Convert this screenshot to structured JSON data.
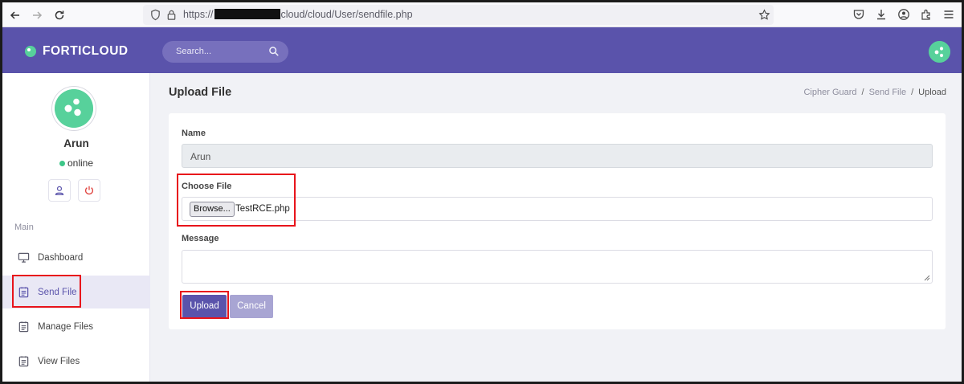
{
  "browser": {
    "url_prefix": "https://",
    "url_suffix": "cloud/cloud/User/sendfile.php"
  },
  "header": {
    "brand": "FORTICLOUD",
    "search_placeholder": "Search..."
  },
  "sidebar": {
    "user_name": "Arun",
    "status": "online",
    "section_label": "Main",
    "items": [
      {
        "label": "Dashboard",
        "icon": "monitor-icon",
        "active": false
      },
      {
        "label": "Send File",
        "icon": "clipboard-icon",
        "active": true
      },
      {
        "label": "Manage Files",
        "icon": "clipboard-icon",
        "active": false
      },
      {
        "label": "View Files",
        "icon": "clipboard-icon",
        "active": false
      }
    ]
  },
  "main": {
    "title": "Upload File",
    "breadcrumb": [
      "Cipher Guard",
      "Send File",
      "Upload"
    ],
    "form": {
      "name_label": "Name",
      "name_value": "Arun",
      "file_label": "Choose File",
      "browse_label": "Browse...",
      "file_name": "TestRCE.php",
      "message_label": "Message",
      "message_value": "",
      "upload_label": "Upload",
      "cancel_label": "Cancel"
    }
  },
  "colors": {
    "brand_purple": "#5a53ab",
    "accent_green": "#57d19b",
    "highlight_red": "#e8141b"
  }
}
